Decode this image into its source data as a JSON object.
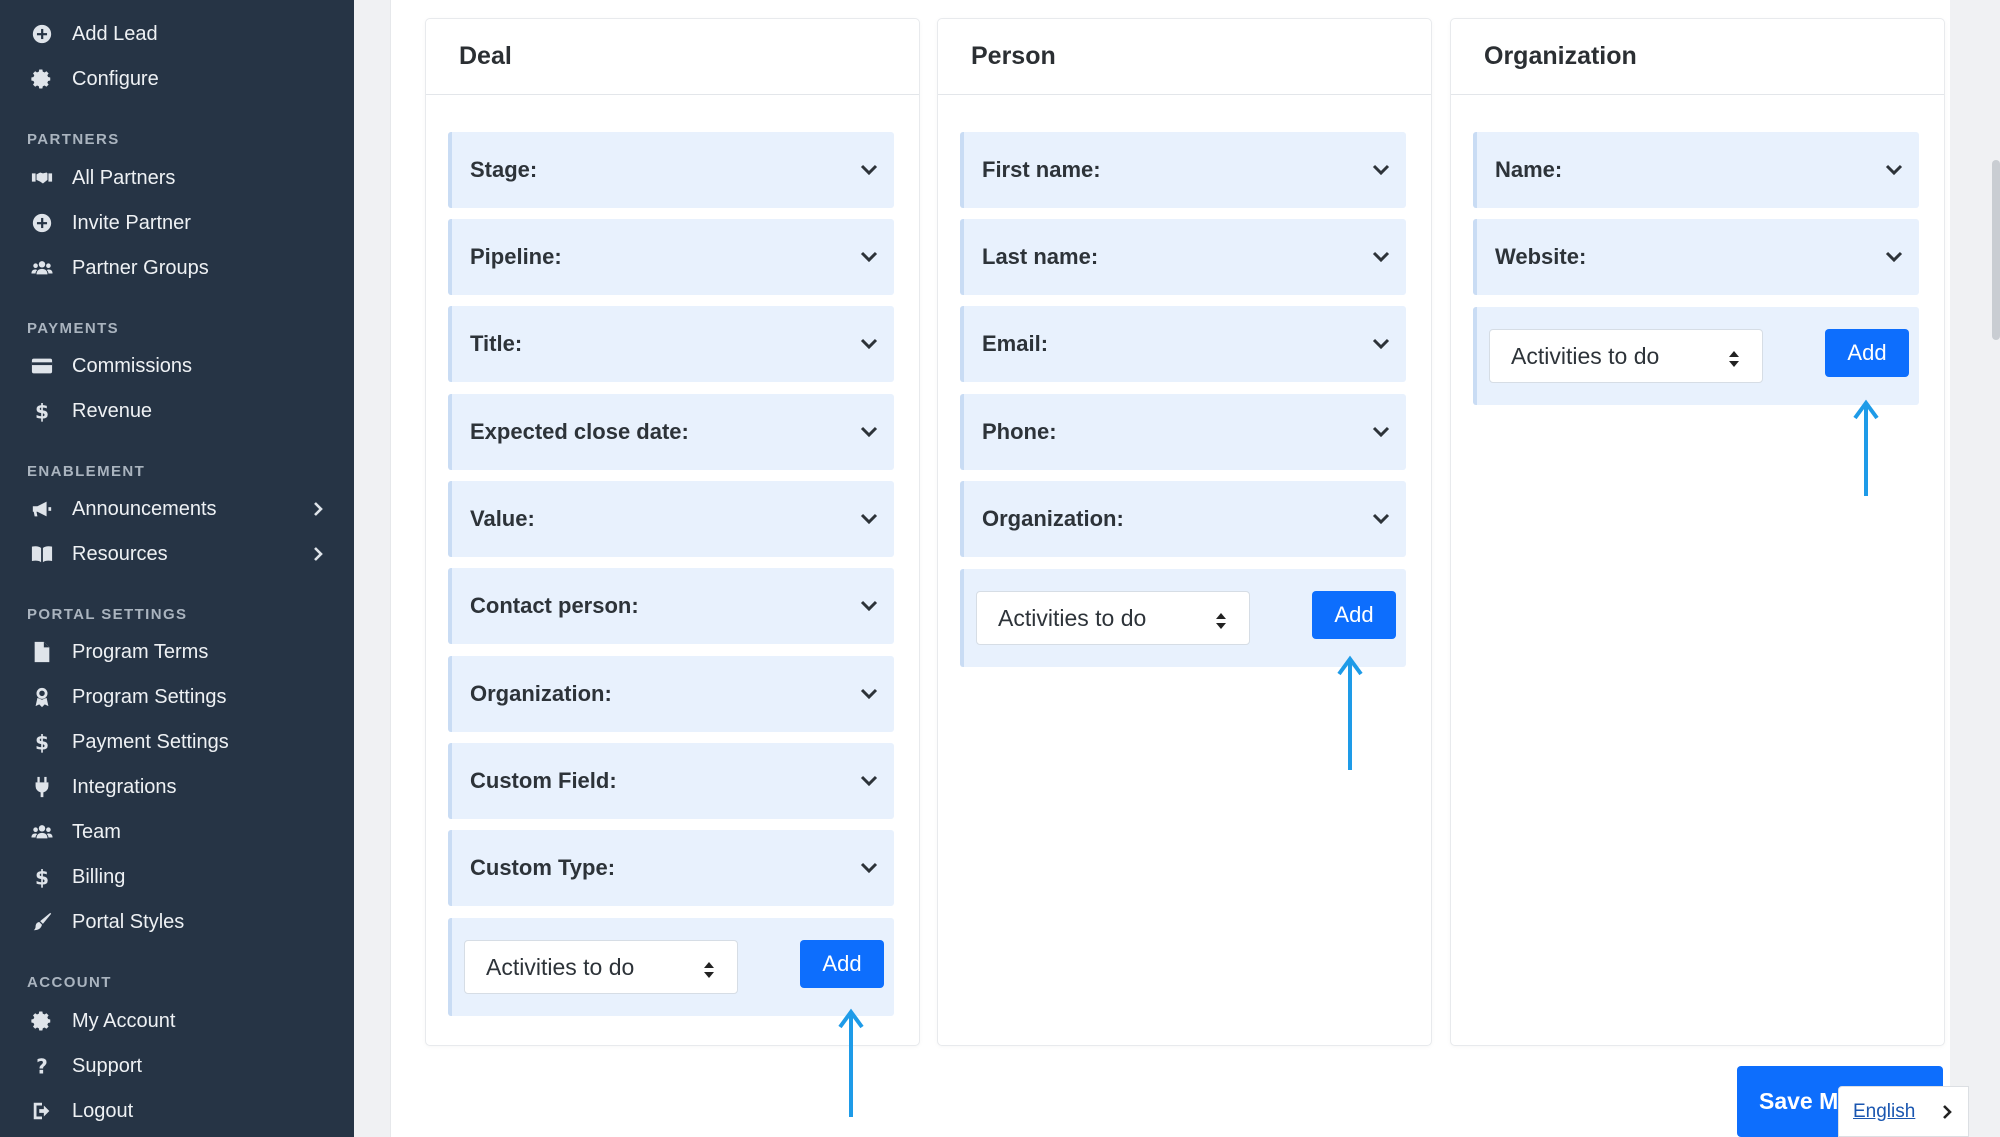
{
  "sidebar": {
    "top_items": [
      {
        "label": "Add Lead",
        "icon": "plus-circle-icon"
      },
      {
        "label": "Configure",
        "icon": "gear-icon"
      }
    ],
    "sections": [
      {
        "title": "PARTNERS",
        "items": [
          {
            "label": "All Partners",
            "icon": "handshake-icon"
          },
          {
            "label": "Invite Partner",
            "icon": "plus-circle-icon"
          },
          {
            "label": "Partner Groups",
            "icon": "users-icon"
          }
        ]
      },
      {
        "title": "PAYMENTS",
        "items": [
          {
            "label": "Commissions",
            "icon": "credit-card-icon"
          },
          {
            "label": "Revenue",
            "icon": "dollar-icon"
          }
        ]
      },
      {
        "title": "ENABLEMENT",
        "items": [
          {
            "label": "Announcements",
            "icon": "megaphone-icon",
            "has_submenu": true
          },
          {
            "label": "Resources",
            "icon": "book-icon",
            "has_submenu": true
          }
        ]
      },
      {
        "title": "PORTAL SETTINGS",
        "items": [
          {
            "label": "Program Terms",
            "icon": "file-icon"
          },
          {
            "label": "Program Settings",
            "icon": "award-icon"
          },
          {
            "label": "Payment Settings",
            "icon": "dollar-icon"
          },
          {
            "label": "Integrations",
            "icon": "plug-icon"
          },
          {
            "label": "Team",
            "icon": "users-icon"
          },
          {
            "label": "Billing",
            "icon": "dollar-icon"
          },
          {
            "label": "Portal Styles",
            "icon": "brush-icon"
          }
        ]
      },
      {
        "title": "ACCOUNT",
        "items": [
          {
            "label": "My Account",
            "icon": "gear-icon"
          },
          {
            "label": "Support",
            "icon": "question-icon"
          },
          {
            "label": "Logout",
            "icon": "logout-icon"
          }
        ]
      }
    ]
  },
  "panels": [
    {
      "title": "Deal",
      "fields": [
        "Stage:",
        "Pipeline:",
        "Title:",
        "Expected close date:",
        "Value:",
        "Contact person:",
        "Organization:",
        "Custom Field:",
        "Custom Type:"
      ],
      "select_value": "Activities to do",
      "add_label": "Add"
    },
    {
      "title": "Person",
      "fields": [
        "First name:",
        "Last name:",
        "Email:",
        "Phone:",
        "Organization:"
      ],
      "select_value": "Activities to do",
      "add_label": "Add"
    },
    {
      "title": "Organization",
      "fields": [
        "Name:",
        "Website:"
      ],
      "select_value": "Activities to do",
      "add_label": "Add"
    }
  ],
  "save_label": "Save M",
  "language": "English",
  "colors": {
    "sidebar_bg": "#263445",
    "accent": "#0d6efd",
    "field_bg": "#e8f1fd",
    "annotation_arrow": "#1e9be8"
  }
}
